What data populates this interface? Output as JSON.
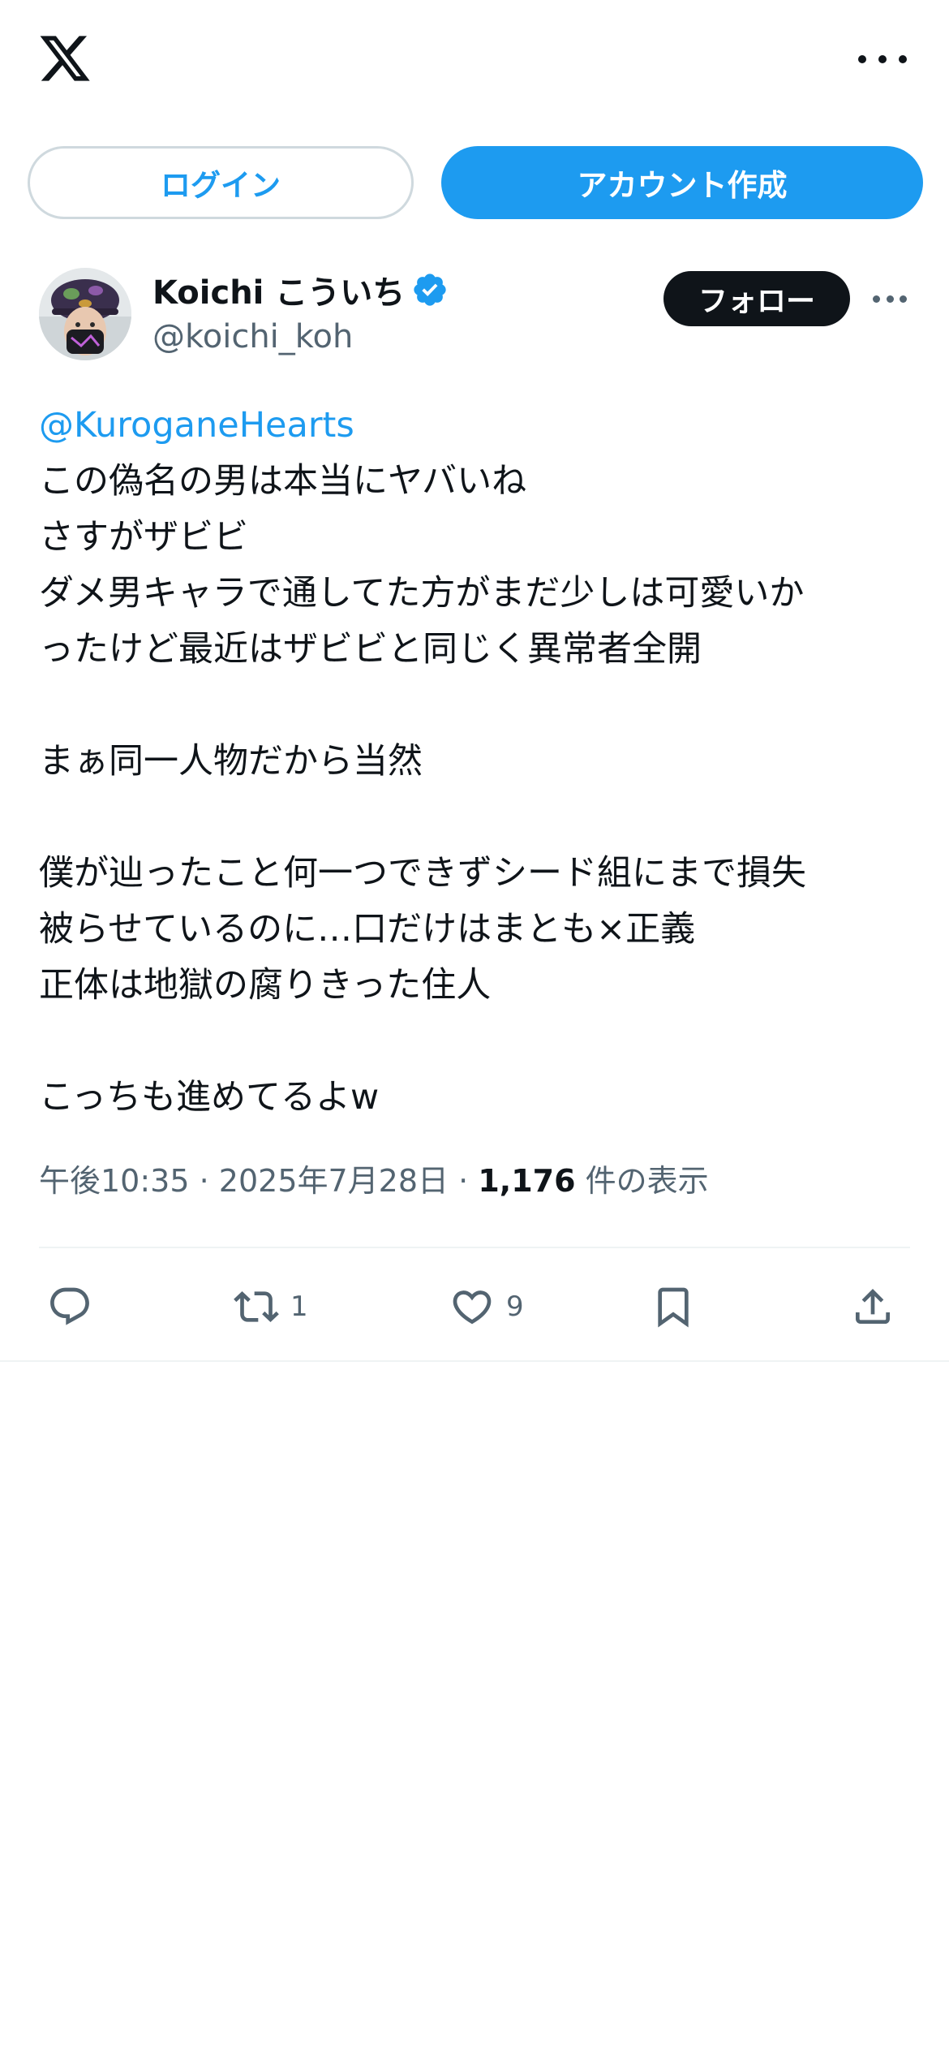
{
  "header": {
    "logo_icon": "x-logo-icon",
    "more_icon": "more-horizontal-icon"
  },
  "auth": {
    "login_label": "ログイン",
    "signup_label": "アカウント作成"
  },
  "tweet": {
    "display_name": "Koichi こういち",
    "handle": "@koichi_koh",
    "verified_icon": "verified-badge-icon",
    "follow_label": "フォロー",
    "more_icon": "more-horizontal-icon",
    "mention": "@KuroganeHearts",
    "text": "この偽名の男は本当にヤバいね\nさすがザビビ\nダメ男キャラで通してた方がまだ少しは可愛いか\nったけど最近はザビビと同じく異常者全開\n\nまぁ同一人物だから当然\n\n僕が辿ったこと何一つできずシード組にまで損失\n被らせているのに…口だけはまとも×正義\n正体は地獄の腐りきった住人\n\nこっちも進めてるよw",
    "time": "午後10:35",
    "date": "2025年7月28日",
    "views_count": "1,176",
    "views_label": "件の表示",
    "separator": "·"
  },
  "actions": {
    "reply_icon": "reply-icon",
    "retweet_icon": "retweet-icon",
    "retweet_count": "1",
    "like_icon": "heart-icon",
    "like_count": "9",
    "bookmark_icon": "bookmark-icon",
    "share_icon": "share-icon"
  },
  "colors": {
    "accent": "#1d9bf0",
    "text": "#0f1419",
    "secondary": "#536471",
    "border": "#cfd9de"
  }
}
